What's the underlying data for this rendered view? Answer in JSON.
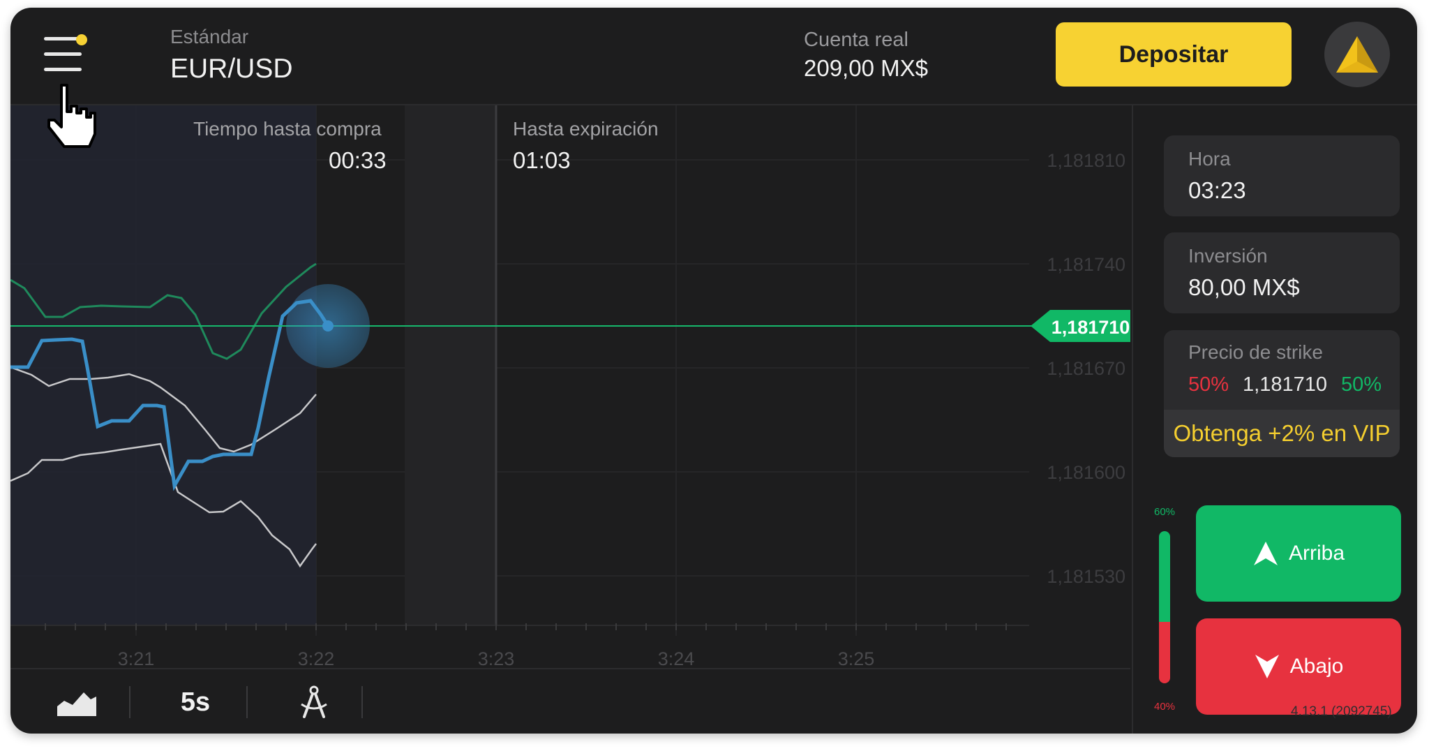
{
  "header": {
    "account_type": "Estándar",
    "asset": "EUR/USD",
    "balance_label": "Cuenta real",
    "balance_value": "209,00 MX$",
    "deposit_label": "Depositar",
    "accent_color": "#f7d232"
  },
  "chart": {
    "purchase_time_label": "Tiempo hasta compra",
    "purchase_time_value": "00:33",
    "expiration_label": "Hasta expiración",
    "expiration_value": "01:03",
    "price_labels": [
      "1,181810",
      "1,181740",
      "1,181670",
      "1,181600",
      "1,181530"
    ],
    "current_price_tag": "1,181710",
    "time_labels": [
      "3:21",
      "3:22",
      "3:23",
      "3:24",
      "3:25"
    ]
  },
  "panel": {
    "time_label": "Hora",
    "time_value": "03:23",
    "investment_label": "Inversión",
    "investment_value": "80,00 MX$",
    "strike_label": "Precio de strike",
    "strike_down_pct": "50%",
    "strike_price": "1,181710",
    "strike_up_pct": "50%",
    "vip_label": "Obtenga +2% en VIP",
    "up_button": "Arriba",
    "down_button": "Abajo",
    "sentiment_up_pct": "60%",
    "sentiment_down_pct": "40%",
    "sentiment_up_value": 0.6
  },
  "toolbar": {
    "chart_type_icon": "area-chart-icon",
    "timeframe_label": "5s",
    "drawing_tool_icon": "compass-icon"
  },
  "version": "4.13.1 (2092745)",
  "colors": {
    "up": "#11b866",
    "down": "#e7323f",
    "price_line": "#3a8fc8",
    "background": "#1d1d1e"
  }
}
